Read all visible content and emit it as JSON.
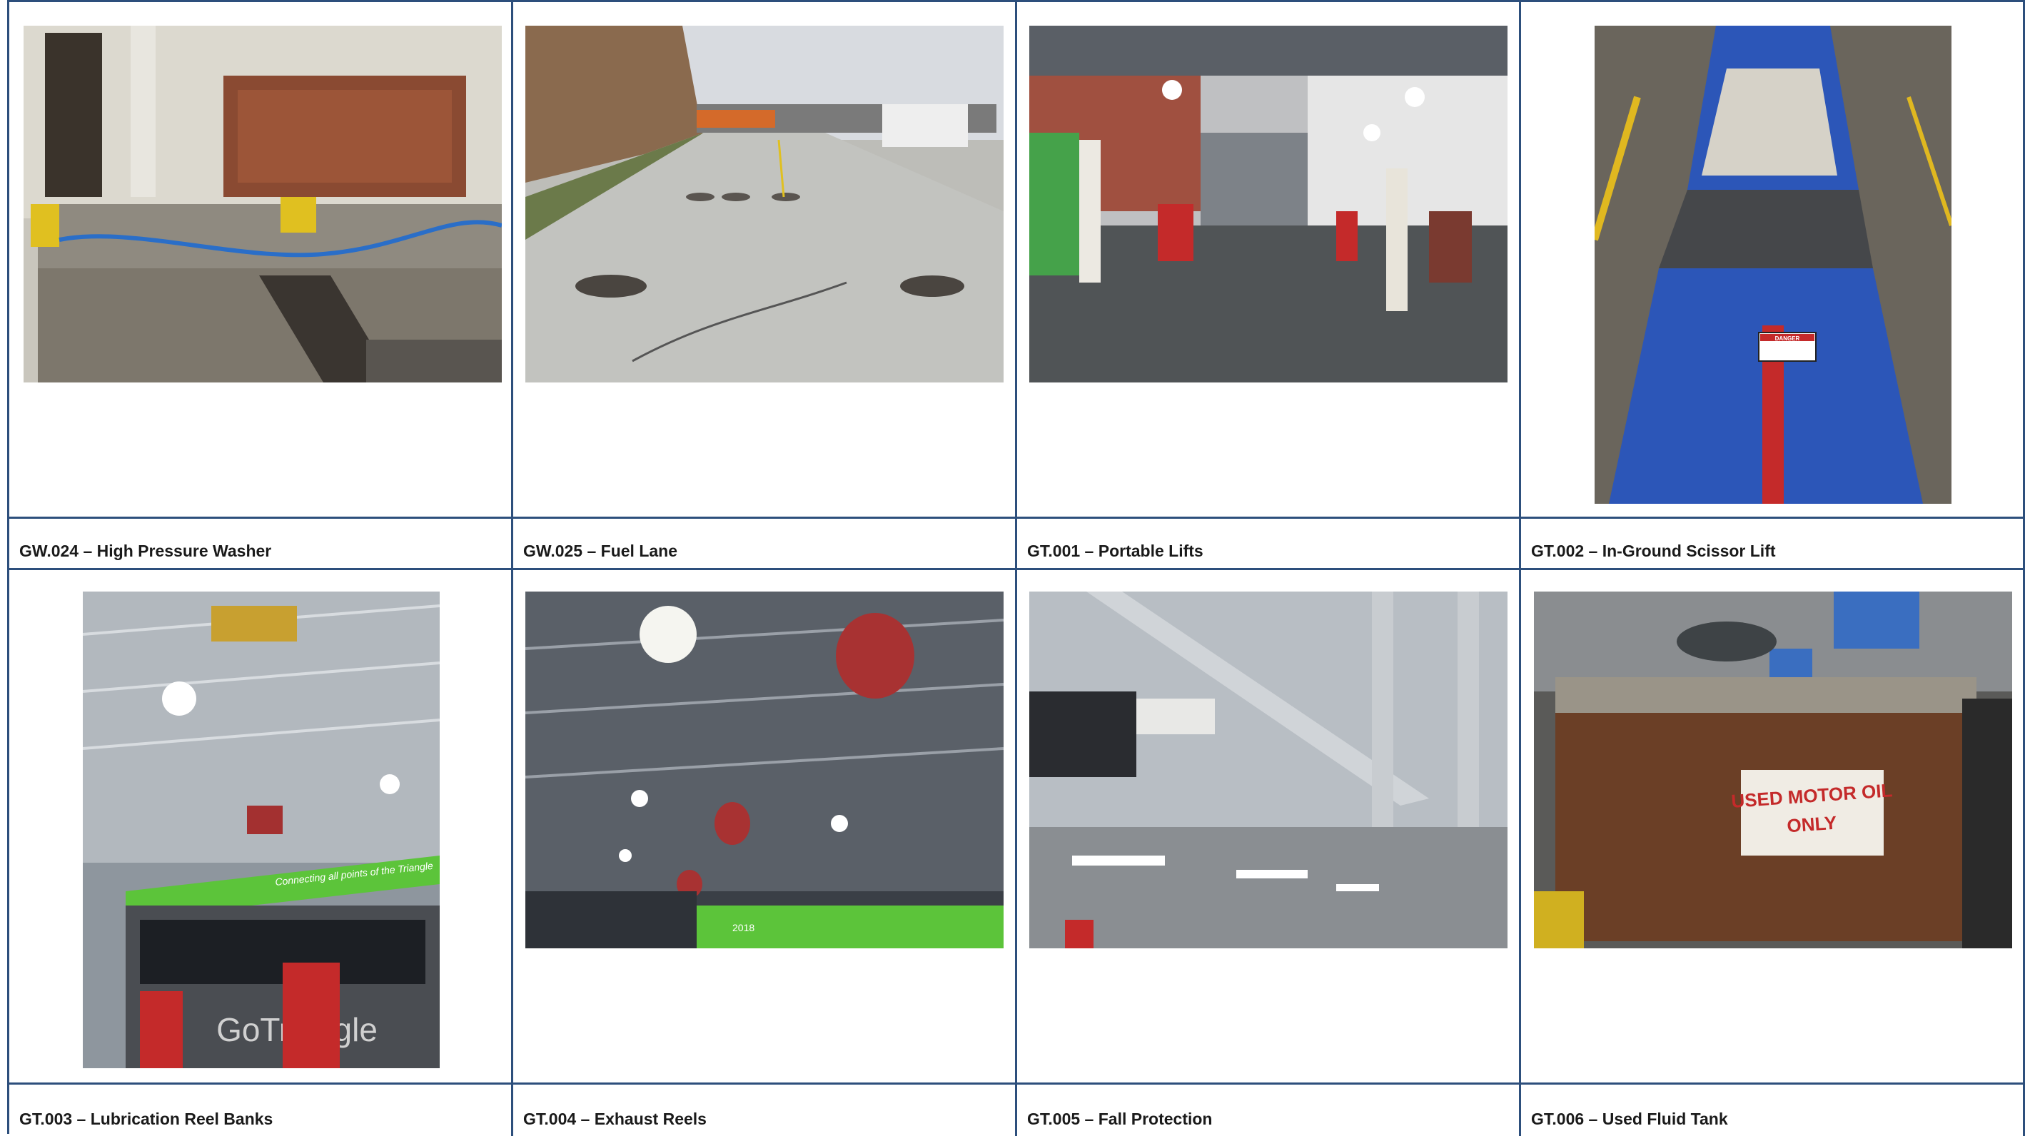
{
  "captions": {
    "c1": "GW.024 – High Pressure Washer",
    "c2": "GW.025 – Fuel Lane",
    "c3": "GT.001 – Portable Lifts",
    "c4": "GT.002 – In-Ground Scissor Lift",
    "c5": "GT.003 – Lubrication Reel Banks",
    "c6": "GT.004 – Exhaust Reels",
    "c7": "GT.005 – Fall Protection",
    "c8": "GT.006 – Used Fluid Tank"
  },
  "photo_text": {
    "danger_sign": "DANGER",
    "oil_tank_line1": "USED MOTOR OIL",
    "oil_tank_line2": "ONLY",
    "bus_banner": "Connecting all points of the Triangle",
    "bus_brand": "GoTriangle",
    "bus_year": "2018"
  },
  "colors": {
    "border": "#2d4f7c",
    "caption_text": "#1a1a1a",
    "bus_green": "#5cc43a",
    "lift_blue": "#2c56b8"
  }
}
